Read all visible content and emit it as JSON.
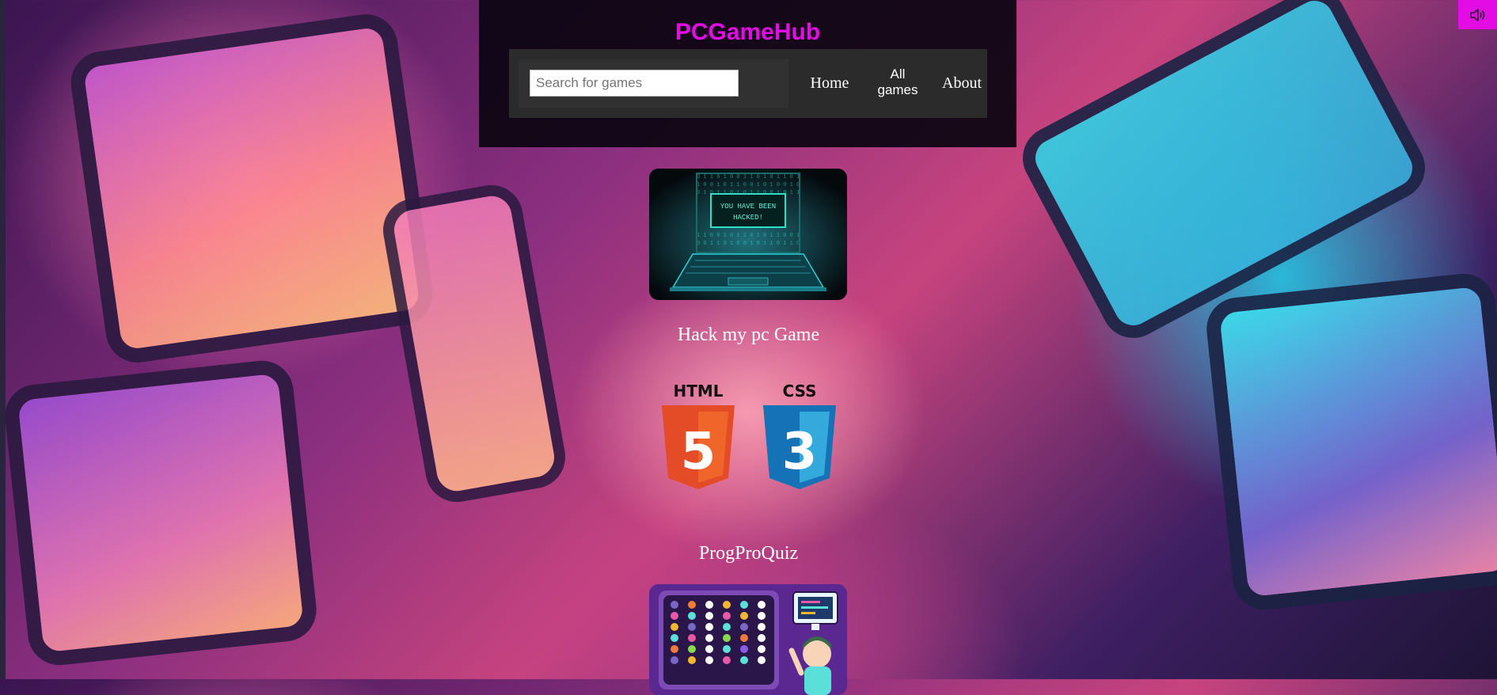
{
  "header": {
    "site_title": "PCGameHub",
    "search_placeholder": "Search for games",
    "search_value": "",
    "nav": {
      "home": "Home",
      "all_games": "All games",
      "about": "About"
    }
  },
  "games": [
    {
      "title": "Hack my pc Game",
      "screen_text_line1": "YOU HAVE BEEN",
      "screen_text_line2": "HACKED!"
    },
    {
      "title": "ProgProQuiz",
      "logo_html": "HTML",
      "logo_html_num": "5",
      "logo_css": "CSS",
      "logo_css_num": "3"
    }
  ],
  "controls": {
    "sound_icon": "speaker-icon"
  },
  "colors": {
    "accent": "#e40ce4",
    "header_bg": "#0a0410",
    "navbar_bg": "#2b2b2b"
  }
}
